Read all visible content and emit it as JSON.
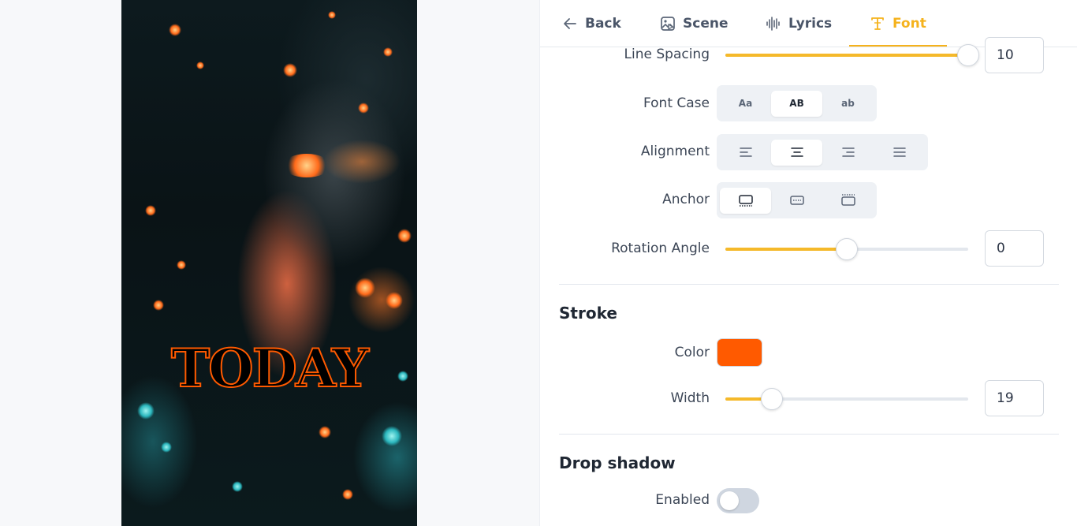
{
  "preview": {
    "overlay_text": "TODAY"
  },
  "nav": {
    "back": "Back",
    "scene": "Scene",
    "lyrics": "Lyrics",
    "font": "Font",
    "active": "Font"
  },
  "text_settings": {
    "line_spacing": {
      "label": "Line Spacing",
      "value": "10",
      "fraction": 1.0
    },
    "font_case": {
      "label": "Font Case",
      "options": [
        "Aa",
        "AB",
        "ab"
      ],
      "selected": "AB"
    },
    "alignment": {
      "label": "Alignment",
      "options": [
        "left",
        "center",
        "right",
        "justify"
      ],
      "selected": "center"
    },
    "anchor": {
      "label": "Anchor",
      "options": [
        "bottom",
        "middle",
        "top"
      ],
      "selected": "bottom"
    },
    "rotation_angle": {
      "label": "Rotation Angle",
      "value": "0",
      "fraction": 0.5
    }
  },
  "stroke": {
    "title": "Stroke",
    "color_label": "Color",
    "color": "#ff5a00",
    "width_label": "Width",
    "width_value": "19",
    "width_fraction": 0.19
  },
  "drop_shadow": {
    "title": "Drop shadow",
    "enabled_label": "Enabled",
    "enabled": false
  },
  "colors": {
    "accent": "#f5b21c",
    "stroke_color": "#ff5a00"
  }
}
